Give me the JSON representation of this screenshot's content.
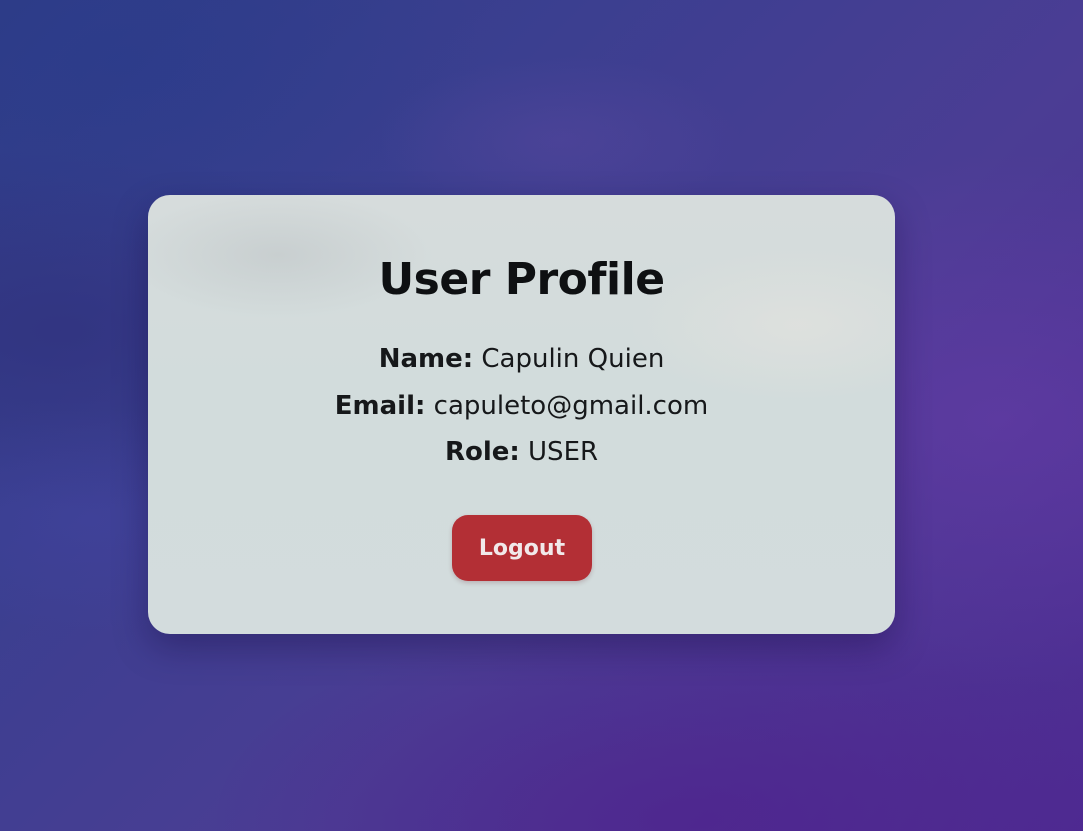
{
  "profile": {
    "title": "User Profile",
    "fields": {
      "name_label": "Name:",
      "name_value": "Capulin Quien",
      "email_label": "Email:",
      "email_value": "capuleto@gmail.com",
      "role_label": "Role:",
      "role_value": "USER"
    },
    "logout_label": "Logout"
  },
  "colors": {
    "accent_button": "#b32f35",
    "card_background": "#d3dcdd",
    "page_background": "#3b3f90"
  }
}
